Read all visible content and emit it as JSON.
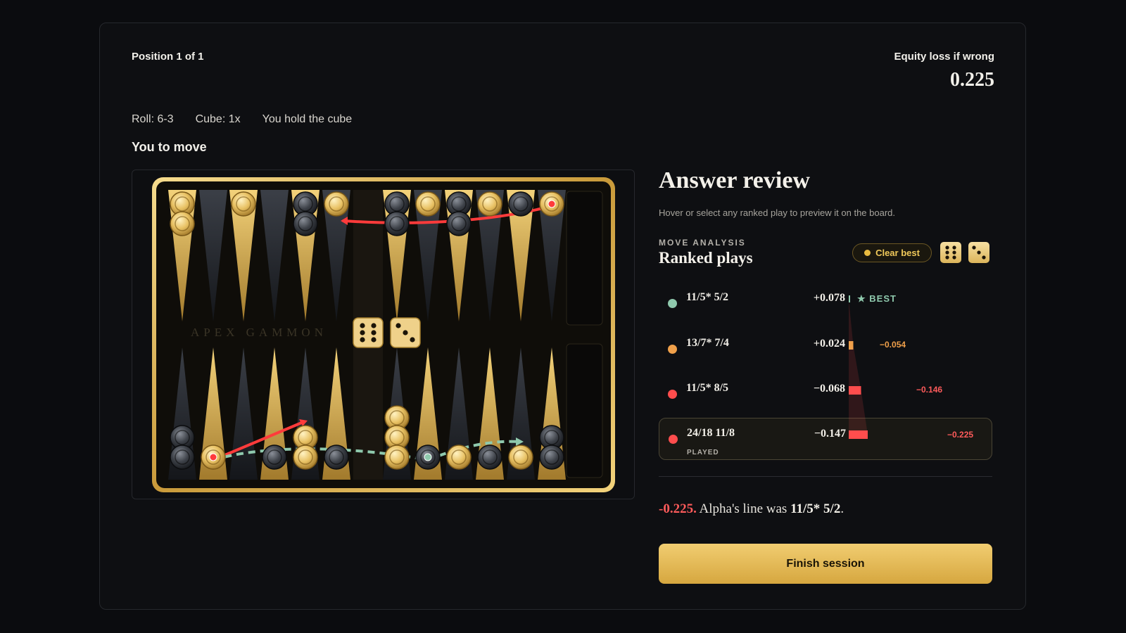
{
  "header": {
    "position_label": "Position 1 of 1",
    "equity_label": "Equity loss if wrong",
    "equity_value": "0.225"
  },
  "meta": {
    "roll": "Roll: 6-3",
    "cube": "Cube: 1x",
    "cube_owner": "You hold the cube"
  },
  "to_move": "You to move",
  "board": {
    "brand": "APEX GAMMON",
    "dice": [
      6,
      3
    ]
  },
  "review": {
    "title": "Answer review",
    "subtitle": "Hover or select any ranked play to preview it on the board.",
    "section_label": "MOVE ANALYSIS",
    "section_title": "Ranked plays",
    "clear_best_label": "Clear best",
    "best_tag": "BEST",
    "played_tag": "PLAYED",
    "plays": [
      {
        "move": "11/5* 5/2",
        "equity": "+0.078",
        "loss": "",
        "color": "#8fc9ad",
        "loss_value": 0
      },
      {
        "move": "13/7* 7/4",
        "equity": "+0.024",
        "loss": "−0.054",
        "color": "#f0a04a",
        "loss_value": 0.054
      },
      {
        "move": "11/5* 8/5",
        "equity": "−0.068",
        "loss": "−0.146",
        "color": "#ff4d4d",
        "loss_value": 0.146
      },
      {
        "move": "24/18 11/8",
        "equity": "−0.147",
        "loss": "−0.225",
        "color": "#ff4d4d",
        "loss_value": 0.225
      }
    ],
    "summary_loss": "-0.225.",
    "summary_text": "Alpha's line was",
    "summary_move": "11/5* 5/2",
    "summary_end": ".",
    "finish_label": "Finish session"
  }
}
